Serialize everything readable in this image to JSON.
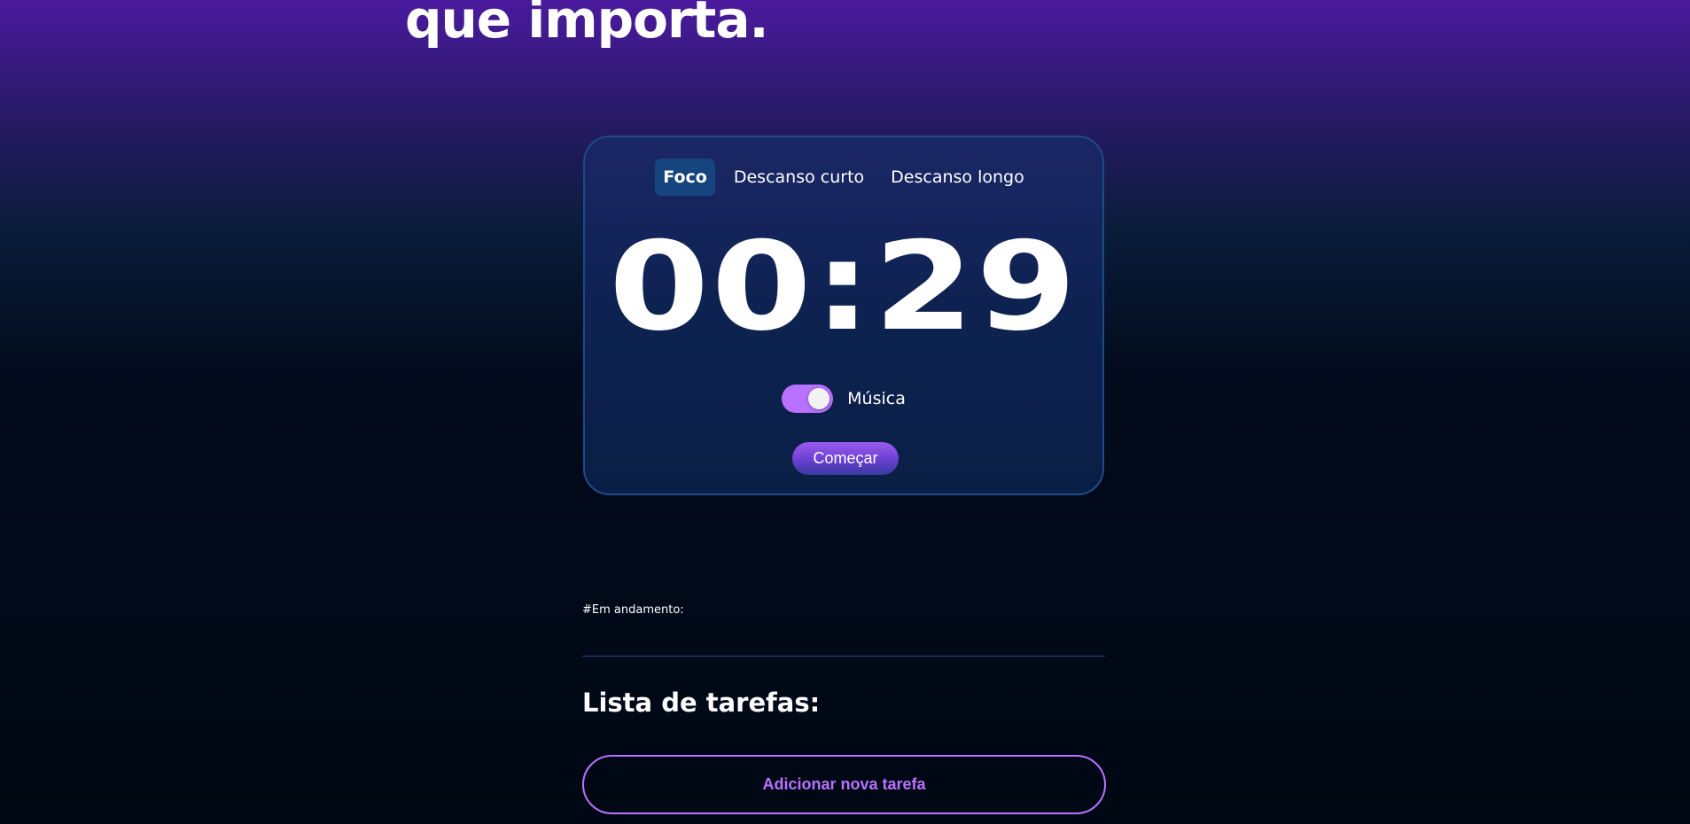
{
  "hero": {
    "title_line": "que importa."
  },
  "timer": {
    "tabs": [
      {
        "label": "Foco",
        "active": true
      },
      {
        "label": "Descanso curto",
        "active": false
      },
      {
        "label": "Descanso longo",
        "active": false
      }
    ],
    "display": "00:29",
    "music_label": "Música",
    "music_enabled": true,
    "start_label": "Começar"
  },
  "tasks": {
    "in_progress_label": "#Em andamento:",
    "list_title": "Lista de tarefas:",
    "add_button_label": "Adicionar nova tarefa"
  },
  "colors": {
    "accent": "#b872ff",
    "card_border": "#1e4a8a",
    "active_tab": "#15447f"
  }
}
